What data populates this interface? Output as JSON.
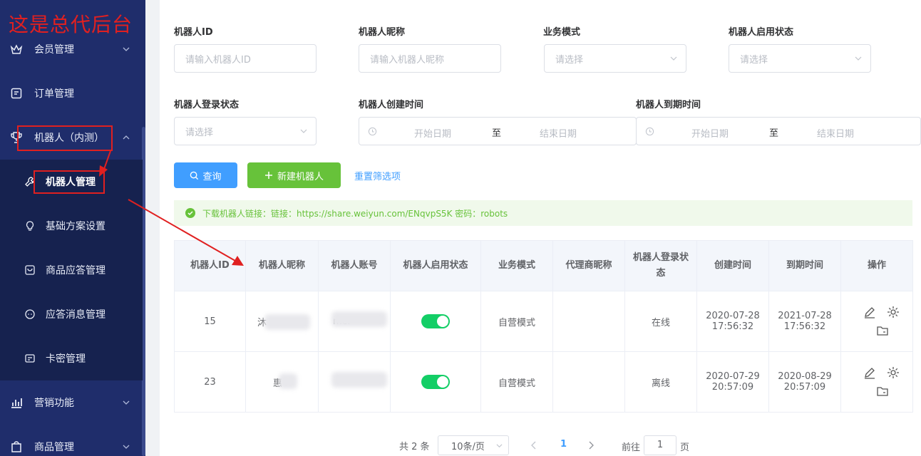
{
  "annotation": {
    "title": "这是总代后台"
  },
  "sidebar": {
    "items": [
      {
        "label": "会员管理",
        "icon": "crown-icon"
      },
      {
        "label": "订单管理",
        "icon": "document-icon"
      },
      {
        "label": "机器人（内测）",
        "icon": "trophy-icon"
      },
      {
        "label": "机器人管理",
        "icon": "wrench-icon"
      },
      {
        "label": "基础方案设置",
        "icon": "lightbulb-icon"
      },
      {
        "label": "商品应答管理",
        "icon": "message-box-icon"
      },
      {
        "label": "应答消息管理",
        "icon": "chat-icon"
      },
      {
        "label": "卡密管理",
        "icon": "card-icon"
      },
      {
        "label": "营销功能",
        "icon": "chart-icon"
      },
      {
        "label": "商品管理",
        "icon": "goods-icon"
      }
    ]
  },
  "filters": {
    "robot_id": {
      "label": "机器人ID",
      "placeholder": "请输入机器人ID"
    },
    "nickname": {
      "label": "机器人昵称",
      "placeholder": "请输入机器人昵称"
    },
    "biz_mode": {
      "label": "业务模式",
      "placeholder": "请选择"
    },
    "enable_status": {
      "label": "机器人启用状态",
      "placeholder": "请选择"
    },
    "login_status": {
      "label": "机器人登录状态",
      "placeholder": "请选择"
    },
    "created": {
      "label": "机器人创建时间",
      "start": "开始日期",
      "sep": "至",
      "end": "结束日期"
    },
    "expires": {
      "label": "机器人到期时间",
      "start": "开始日期",
      "sep": "至",
      "end": "结束日期"
    }
  },
  "actions": {
    "search": "查询",
    "create": "新建机器人",
    "reset": "重置筛选项"
  },
  "alert": {
    "text": "下载机器人链接：链接：https://share.weiyun.com/ENqvpS5K 密码：robots"
  },
  "table": {
    "headers": [
      "机器人ID",
      "机器人昵称",
      "机器人账号",
      "机器人启用状态",
      "业务模式",
      "代理商昵称",
      "机器人登录状态",
      "创建时间",
      "到期时间",
      "操作"
    ],
    "rows": [
      {
        "id": "15",
        "nickname": "沐",
        "account": "mer",
        "enabled": true,
        "mode": "自营模式",
        "agent": "",
        "login": "在线",
        "created": "2020-07-28 17:56:32",
        "expires": "2021-07-28 17:56:32"
      },
      {
        "id": "23",
        "nickname": "惠",
        "account": "",
        "enabled": true,
        "mode": "自营模式",
        "agent": "",
        "login": "离线",
        "created": "2020-07-29 20:57:09",
        "expires": "2020-08-29 20:57:09"
      }
    ]
  },
  "pagination": {
    "total": "共 2 条",
    "page_size": "10条/页",
    "current": "1",
    "goto_label": "前往",
    "goto_value": "1",
    "page_suffix": "页"
  },
  "colors": {
    "sidebar_bg": "#1f2d6b",
    "primary": "#409eff",
    "success": "#67c23a",
    "switch_on": "#13ce66",
    "annotation": "#e02020"
  }
}
